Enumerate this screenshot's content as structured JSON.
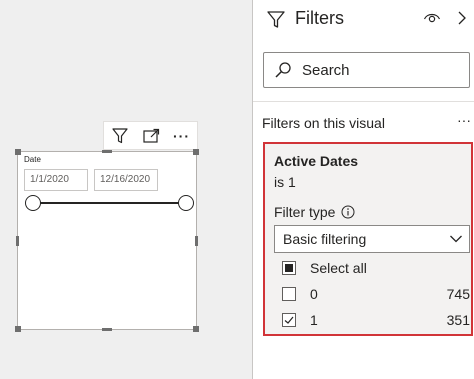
{
  "visual": {
    "header_icons": [
      "filter-icon",
      "focus-mode-icon",
      "more-options-icon"
    ],
    "more_label": "···",
    "slicer": {
      "title": "Date",
      "start_date": "1/1/2020",
      "end_date": "12/16/2020"
    }
  },
  "filters_pane": {
    "title": "Filters",
    "search_placeholder": "Search",
    "section_label": "Filters on this visual",
    "section_more": "···",
    "card": {
      "field": "Active Dates",
      "condition": "is 1",
      "filter_type_label": "Filter type",
      "filter_type_value": "Basic filtering",
      "options": [
        {
          "label": "Select all",
          "count": "",
          "state": "partial"
        },
        {
          "label": "0",
          "count": "745",
          "state": "unchecked"
        },
        {
          "label": "1",
          "count": "351",
          "state": "checked"
        }
      ]
    },
    "highlight_color": "#d13438"
  }
}
